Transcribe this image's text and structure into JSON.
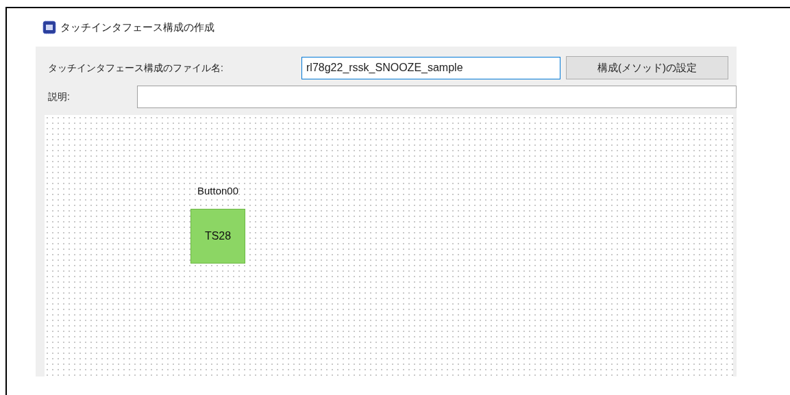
{
  "window": {
    "title": "タッチインタフェース構成の作成"
  },
  "file_name": {
    "label": "タッチインタフェース構成のファイル名:",
    "value": "rl78g22_rssk_SNOOZE_sample"
  },
  "method_button": {
    "label": "構成(メソッド)の設定"
  },
  "description": {
    "label": "説明:"
  },
  "canvas": {
    "nodes": [
      {
        "name": "Button00",
        "channel": "TS28"
      }
    ]
  }
}
